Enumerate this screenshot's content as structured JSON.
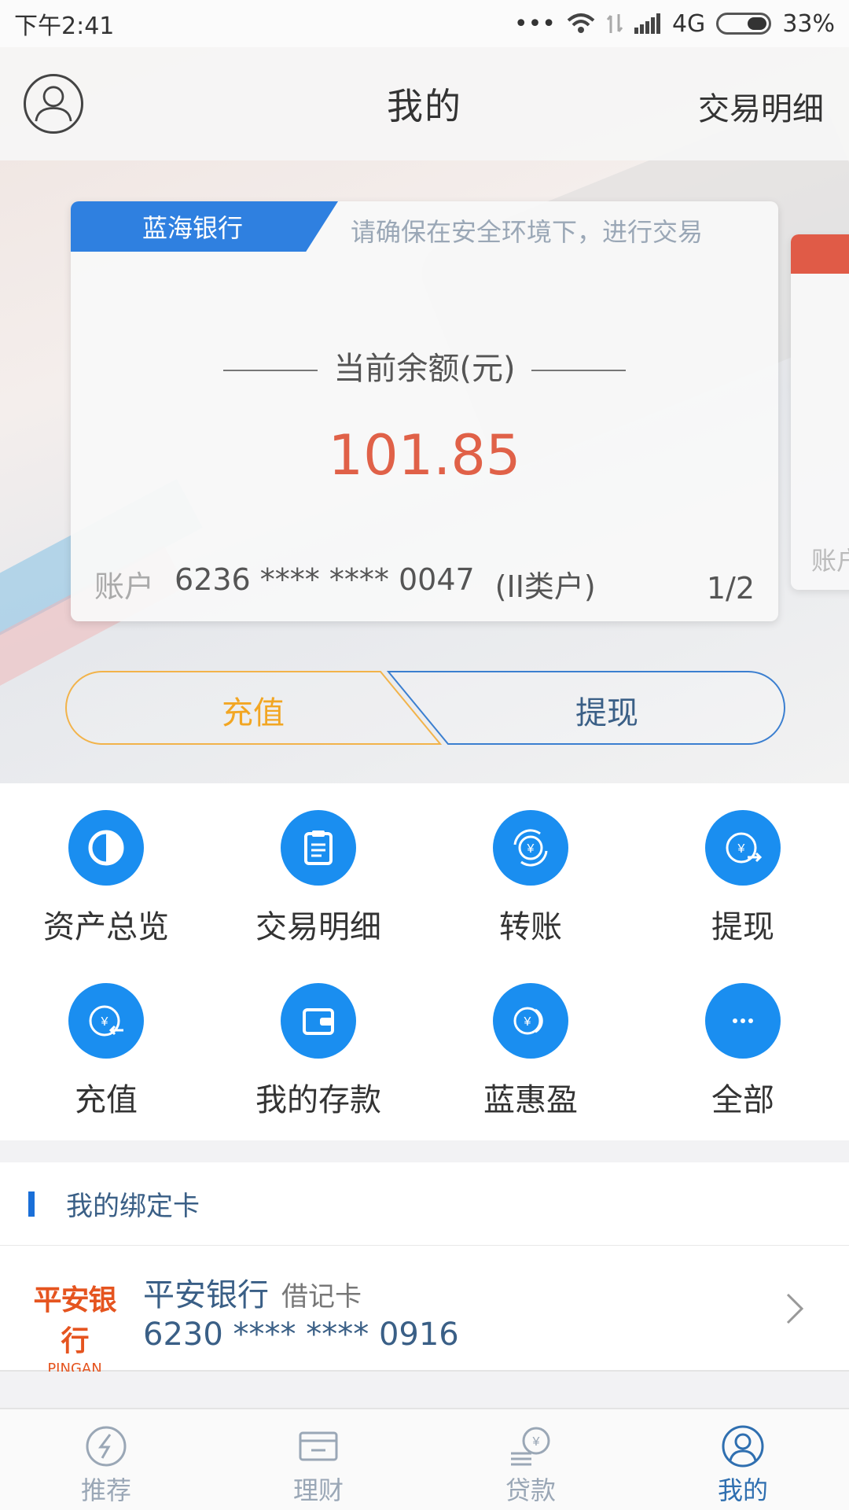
{
  "status_bar": {
    "time": "下午2:41",
    "network": "4G",
    "battery": "33%"
  },
  "header": {
    "title": "我的",
    "right_link": "交易明细"
  },
  "account_card": {
    "bank": "蓝海银行",
    "tip": "请确保在安全环境下，进行交易",
    "balance_label": "当前余额(元)",
    "balance": "101.85",
    "account_label": "账户",
    "account_no": "6236 **** **** 0047",
    "account_type": "(II类户)",
    "page": "1/2"
  },
  "next_card": {
    "account_label": "账户"
  },
  "actions": {
    "recharge": "充值",
    "withdraw": "提现"
  },
  "grid": [
    {
      "label": "资产总览",
      "icon": "pie-chart-icon"
    },
    {
      "label": "交易明细",
      "icon": "clipboard-icon"
    },
    {
      "label": "转账",
      "icon": "yen-transfer-icon"
    },
    {
      "label": "提现",
      "icon": "yen-withdraw-icon"
    },
    {
      "label": "充值",
      "icon": "yen-recharge-icon"
    },
    {
      "label": "我的存款",
      "icon": "wallet-icon"
    },
    {
      "label": "蓝惠盈",
      "icon": "yen-coins-icon"
    },
    {
      "label": "全部",
      "icon": "more-icon"
    }
  ],
  "bound_cards": {
    "title": "我的绑定卡",
    "items": [
      {
        "logo_cn": "平安银行",
        "logo_en": "PINGAN BANK",
        "bank": "平安银行",
        "type": "借记卡",
        "number": "6230 **** **** 0916"
      }
    ]
  },
  "tabbar": [
    {
      "label": "推荐",
      "icon": "recommend-icon",
      "active": false
    },
    {
      "label": "理财",
      "icon": "wealth-card-icon",
      "active": false
    },
    {
      "label": "贷款",
      "icon": "loan-icon",
      "active": false
    },
    {
      "label": "我的",
      "icon": "profile-icon",
      "active": true
    }
  ],
  "colors": {
    "brand_blue": "#1a8ef0",
    "amount_red": "#e06148",
    "recharge_orange": "#f2a623"
  }
}
